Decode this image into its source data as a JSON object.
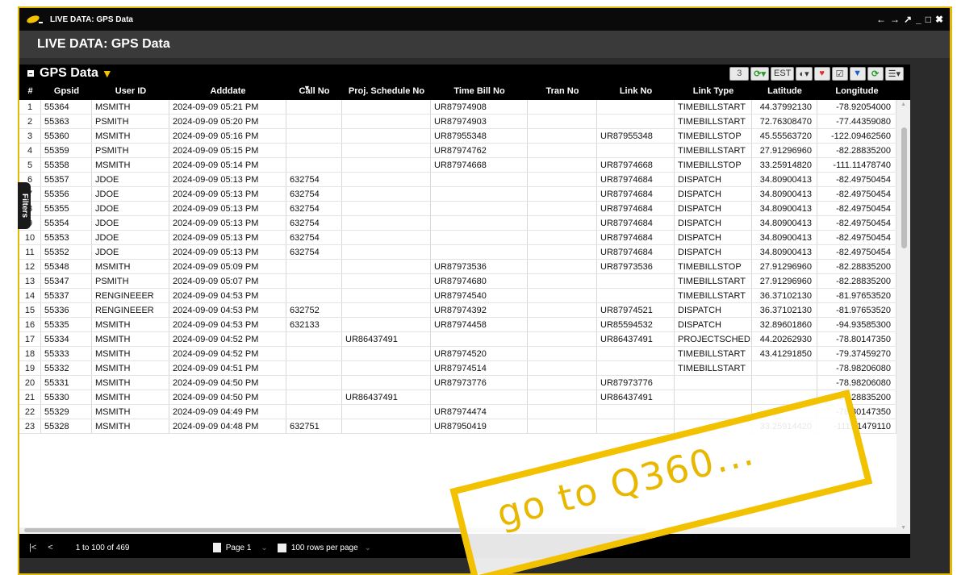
{
  "window": {
    "title": "LIVE DATA: GPS Data",
    "controls": [
      "←",
      "→",
      "↗",
      "_",
      "□",
      "✖"
    ]
  },
  "page": {
    "title": "LIVE DATA: GPS Data"
  },
  "panel": {
    "title": "GPS Data",
    "toolbar": {
      "count": "3",
      "timezone": "EST"
    }
  },
  "filters_tab": "Filters",
  "columns": [
    "#",
    "Gpsid",
    "User ID",
    "Adddate",
    "Call No",
    "Proj. Schedule No",
    "Time Bill No",
    "Tran No",
    "Link No",
    "Link Type",
    "Latitude",
    "Longitude"
  ],
  "rows": [
    [
      "1",
      "55364",
      "MSMITH",
      "2024-09-09 05:21 PM",
      "",
      "",
      "UR87974908",
      "",
      "",
      "TIMEBILLSTART",
      "44.37992130",
      "-78.92054000"
    ],
    [
      "2",
      "55363",
      "PSMITH",
      "2024-09-09 05:20 PM",
      "",
      "",
      "UR87974903",
      "",
      "",
      "TIMEBILLSTART",
      "72.76308470",
      "-77.44359080"
    ],
    [
      "3",
      "55360",
      "MSMITH",
      "2024-09-09 05:16 PM",
      "",
      "",
      "UR87955348",
      "",
      "UR87955348",
      "TIMEBILLSTOP",
      "45.55563720",
      "-122.09462560"
    ],
    [
      "4",
      "55359",
      "PSMITH",
      "2024-09-09 05:15 PM",
      "",
      "",
      "UR87974762",
      "",
      "",
      "TIMEBILLSTART",
      "27.91296960",
      "-82.28835200"
    ],
    [
      "5",
      "55358",
      "MSMITH",
      "2024-09-09 05:14 PM",
      "",
      "",
      "UR87974668",
      "",
      "UR87974668",
      "TIMEBILLSTOP",
      "33.25914820",
      "-111.11478740"
    ],
    [
      "6",
      "55357",
      "JDOE",
      "2024-09-09 05:13 PM",
      "632754",
      "",
      "",
      "",
      "UR87974684",
      "DISPATCH",
      "34.80900413",
      "-82.49750454"
    ],
    [
      "7",
      "55356",
      "JDOE",
      "2024-09-09 05:13 PM",
      "632754",
      "",
      "",
      "",
      "UR87974684",
      "DISPATCH",
      "34.80900413",
      "-82.49750454"
    ],
    [
      "8",
      "55355",
      "JDOE",
      "2024-09-09 05:13 PM",
      "632754",
      "",
      "",
      "",
      "UR87974684",
      "DISPATCH",
      "34.80900413",
      "-82.49750454"
    ],
    [
      "9",
      "55354",
      "JDOE",
      "2024-09-09 05:13 PM",
      "632754",
      "",
      "",
      "",
      "UR87974684",
      "DISPATCH",
      "34.80900413",
      "-82.49750454"
    ],
    [
      "10",
      "55353",
      "JDOE",
      "2024-09-09 05:13 PM",
      "632754",
      "",
      "",
      "",
      "UR87974684",
      "DISPATCH",
      "34.80900413",
      "-82.49750454"
    ],
    [
      "11",
      "55352",
      "JDOE",
      "2024-09-09 05:13 PM",
      "632754",
      "",
      "",
      "",
      "UR87974684",
      "DISPATCH",
      "34.80900413",
      "-82.49750454"
    ],
    [
      "12",
      "55348",
      "MSMITH",
      "2024-09-09 05:09 PM",
      "",
      "",
      "UR87973536",
      "",
      "UR87973536",
      "TIMEBILLSTOP",
      "27.91296960",
      "-82.28835200"
    ],
    [
      "13",
      "55347",
      "PSMITH",
      "2024-09-09 05:07 PM",
      "",
      "",
      "UR87974680",
      "",
      "",
      "TIMEBILLSTART",
      "27.91296960",
      "-82.28835200"
    ],
    [
      "14",
      "55337",
      "RENGINEEER",
      "2024-09-09 04:53 PM",
      "",
      "",
      "UR87974540",
      "",
      "",
      "TIMEBILLSTART",
      "36.37102130",
      "-81.97653520"
    ],
    [
      "15",
      "55336",
      "RENGINEEER",
      "2024-09-09 04:53 PM",
      "632752",
      "",
      "UR87974392",
      "",
      "UR87974521",
      "DISPATCH",
      "36.37102130",
      "-81.97653520"
    ],
    [
      "16",
      "55335",
      "MSMITH",
      "2024-09-09 04:53 PM",
      "632133",
      "",
      "UR87974458",
      "",
      "UR85594532",
      "DISPATCH",
      "32.89601860",
      "-94.93585300"
    ],
    [
      "17",
      "55334",
      "MSMITH",
      "2024-09-09 04:52 PM",
      "",
      "UR86437491",
      "",
      "",
      "UR86437491",
      "PROJECTSCHED...",
      "44.20262930",
      "-78.80147350"
    ],
    [
      "18",
      "55333",
      "MSMITH",
      "2024-09-09 04:52 PM",
      "",
      "",
      "UR87974520",
      "",
      "",
      "TIMEBILLSTART",
      "43.41291850",
      "-79.37459270"
    ],
    [
      "19",
      "55332",
      "MSMITH",
      "2024-09-09 04:51 PM",
      "",
      "",
      "UR87974514",
      "",
      "",
      "TIMEBILLSTART",
      "",
      "-78.98206080"
    ],
    [
      "20",
      "55331",
      "MSMITH",
      "2024-09-09 04:50 PM",
      "",
      "",
      "UR87973776",
      "",
      "UR87973776",
      "",
      "",
      "-78.98206080"
    ],
    [
      "21",
      "55330",
      "MSMITH",
      "2024-09-09 04:50 PM",
      "",
      "UR86437491",
      "",
      "",
      "UR86437491",
      "",
      "",
      "-82.28835200"
    ],
    [
      "22",
      "55329",
      "MSMITH",
      "2024-09-09 04:49 PM",
      "",
      "",
      "UR87974474",
      "",
      "",
      "",
      "",
      "-78.80147350"
    ],
    [
      "23",
      "55328",
      "MSMITH",
      "2024-09-09 04:48 PM",
      "632751",
      "",
      "UR87950419",
      "",
      "",
      "",
      "33.25914420",
      "-111.11479110"
    ]
  ],
  "pager": {
    "range": "1 to 100 of 469",
    "page": "Page 1",
    "rows_per_page": "100 rows per page"
  },
  "promo": {
    "text": "go to Q360..."
  }
}
